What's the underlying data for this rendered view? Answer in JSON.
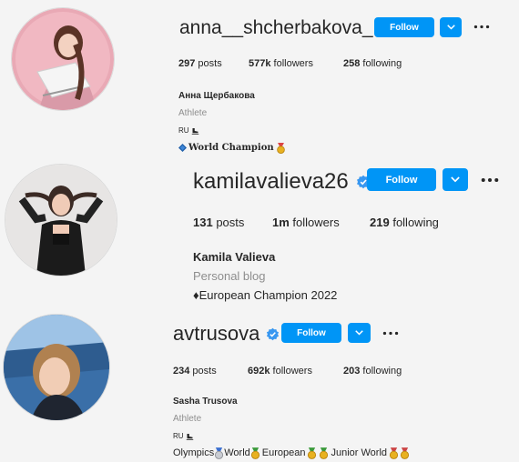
{
  "profiles": [
    {
      "username": "anna__shcherbakova_",
      "follow_label": "Follow",
      "posts_count": "297",
      "posts_label": "posts",
      "followers_count": "577k",
      "followers_label": "followers",
      "following_count": "258",
      "following_label": "following",
      "full_name": "Анна Щербакова",
      "category": "Athlete",
      "country": "RU",
      "bio": "World Champion"
    },
    {
      "username": "kamilavalieva26",
      "follow_label": "Follow",
      "posts_count": "131",
      "posts_label": "posts",
      "followers_count": "1m",
      "followers_label": "followers",
      "following_count": "219",
      "following_label": "following",
      "full_name": "Kamila Valieva",
      "category": "Personal blog",
      "bio": "♦European Champion 2022"
    },
    {
      "username": "avtrusova",
      "follow_label": "Follow",
      "posts_count": "234",
      "posts_label": "posts",
      "followers_count": "692k",
      "followers_label": "followers",
      "following_count": "203",
      "following_label": "following",
      "full_name": "Sasha Trusova",
      "category": "Athlete",
      "country": "RU",
      "bio_olympics": "Olympics",
      "bio_world": "World",
      "bio_european": "European",
      "bio_junior": "Junior World"
    }
  ],
  "colors": {
    "accent": "#0095f6",
    "verified": "#3897f0",
    "secondary_text": "#8e8e8e"
  }
}
